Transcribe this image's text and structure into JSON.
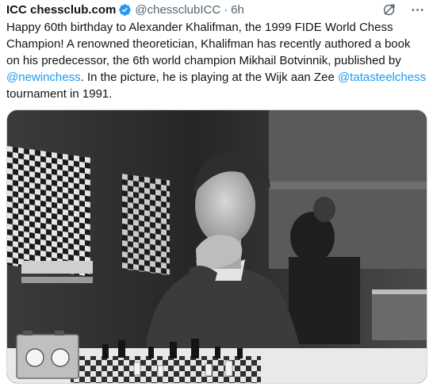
{
  "tweet": {
    "display_name": "ICC chessclub.com",
    "handle": "@chessclubICC",
    "separator": "·",
    "time": "6h",
    "text": {
      "part1": "Happy 60th birthday to Alexander Khalifman, the 1999 FIDE World Chess Champion! A renowned theoretician, Khalifman has recently authored a book on his predecessor, the 6th world champion Mikhail Botvinnik, published by ",
      "mention1": "@newinchess",
      "part2": ". In the picture, he is playing at the Wijk aan Zee ",
      "mention2": "@tatasteelchess",
      "part3": " tournament in 1991."
    },
    "icons": {
      "verified": "verified-badge-icon",
      "grok": "grok-icon",
      "more": "more-icon"
    },
    "photo": {
      "description_icon": "photo",
      "style": "black-and-white"
    }
  },
  "colors": {
    "text": "#0f1419",
    "secondary": "#536471",
    "link": "#1d9bf0",
    "verified": "#1d9bf0"
  }
}
